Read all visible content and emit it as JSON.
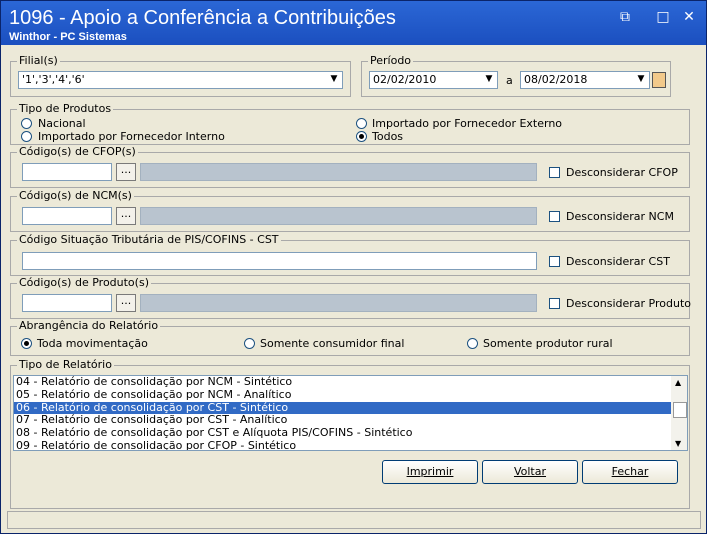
{
  "window": {
    "title": "1096 - Apoio a Conferência a Contribuições",
    "subtitle": "Winthor - PC Sistemas",
    "controls": {
      "restore": "⧉",
      "minimize": "□",
      "close": "✕"
    }
  },
  "filial": {
    "label": "Filial(s)",
    "value": "'1','3','4','6'"
  },
  "periodo": {
    "label": "Período",
    "start": "02/02/2010",
    "separator": "a",
    "end": "08/02/2018"
  },
  "tipo_produtos": {
    "label": "Tipo de Produtos",
    "options": [
      "Nacional",
      "Importado por Fornecedor Interno",
      "Importado por Fornecedor Externo",
      "Todos"
    ],
    "selected": "Todos"
  },
  "cfop": {
    "label": "Código(s) de CFOP(s)",
    "button": "...",
    "checkbox": "Desconsiderar CFOP"
  },
  "ncm": {
    "label": "Código(s) de NCM(s)",
    "button": "...",
    "checkbox": "Desconsiderar NCM"
  },
  "cst": {
    "label": "Código Situação Tributária de PIS/COFINS - CST",
    "checkbox": "Desconsiderar CST"
  },
  "produto": {
    "label": "Código(s) de Produto(s)",
    "button": "...",
    "checkbox": "Desconsiderar Produto"
  },
  "abrangencia": {
    "label": "Abrangência do Relatório",
    "options": [
      "Toda movimentação",
      "Somente consumidor final",
      "Somente produtor rural"
    ],
    "selected": "Toda movimentação"
  },
  "tipo_relatorio": {
    "label": "Tipo de Relatório",
    "items": [
      "04 - Relatório de consolidação por NCM - Sintético",
      "05 - Relatório de consolidação por NCM - Analítico",
      "06 - Relatório de consolidação por CST - Sintético",
      "07 - Relatório de consolidação por CST - Analítico",
      "08 - Relatório de consolidação por CST e Alíquota PIS/COFINS - Sintético",
      "09 - Relatório de consolidação por CFOP - Sintético"
    ],
    "selected_index": 2
  },
  "buttons": {
    "imprimir": "Imprimir",
    "voltar": "Voltar",
    "fechar": "Fechar"
  }
}
